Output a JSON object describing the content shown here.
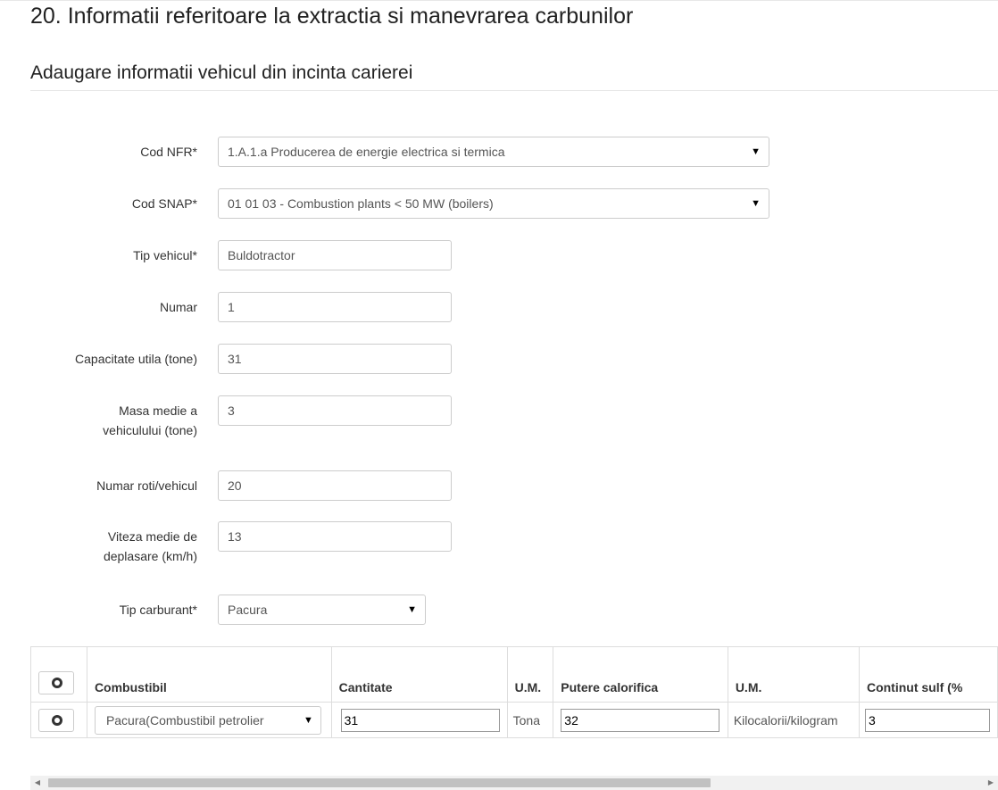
{
  "page_title": "20. Informatii referitoare la extractia si manevrarea carbunilor",
  "section_title": "Adaugare informatii vehicul din incinta carierei",
  "form": {
    "nfr": {
      "label": "Cod NFR*",
      "value": "1.A.1.a Producerea de energie electrica si termica"
    },
    "snap": {
      "label": "Cod SNAP*",
      "value": "01 01 03 - Combustion plants < 50 MW (boilers)"
    },
    "tip_vehicul": {
      "label": "Tip vehicul*",
      "value": "Buldotractor"
    },
    "numar": {
      "label": "Numar",
      "value": "1"
    },
    "capacitate": {
      "label": "Capacitate utila (tone)",
      "value": "31"
    },
    "masa": {
      "label": "Masa medie a vehiculului (tone)",
      "value": "3"
    },
    "roti": {
      "label": "Numar roti/vehicul",
      "value": "20"
    },
    "viteza": {
      "label": "Viteza medie de deplasare (km/h)",
      "value": "13"
    },
    "carburant": {
      "label": "Tip carburant*",
      "value": "Pacura"
    }
  },
  "table": {
    "headers": {
      "combustibil": "Combustibil",
      "cantitate": "Cantitate",
      "um1": "U.M.",
      "putere": "Putere calorifica",
      "um2": "U.M.",
      "sulf": "Continut sulf (%"
    },
    "rows": [
      {
        "combustibil": "Pacura(Combustibil petrolier",
        "cantitate": "31",
        "um1": "Tona",
        "putere": "32",
        "um2": "Kilocalorii/kilogram",
        "sulf": "3"
      }
    ]
  },
  "icons": {
    "add_row": "circle-icon",
    "row_action": "circle-icon",
    "dropdown": "caret-down-icon"
  },
  "scroll": {
    "horizontal_position_fraction": 0.0
  }
}
